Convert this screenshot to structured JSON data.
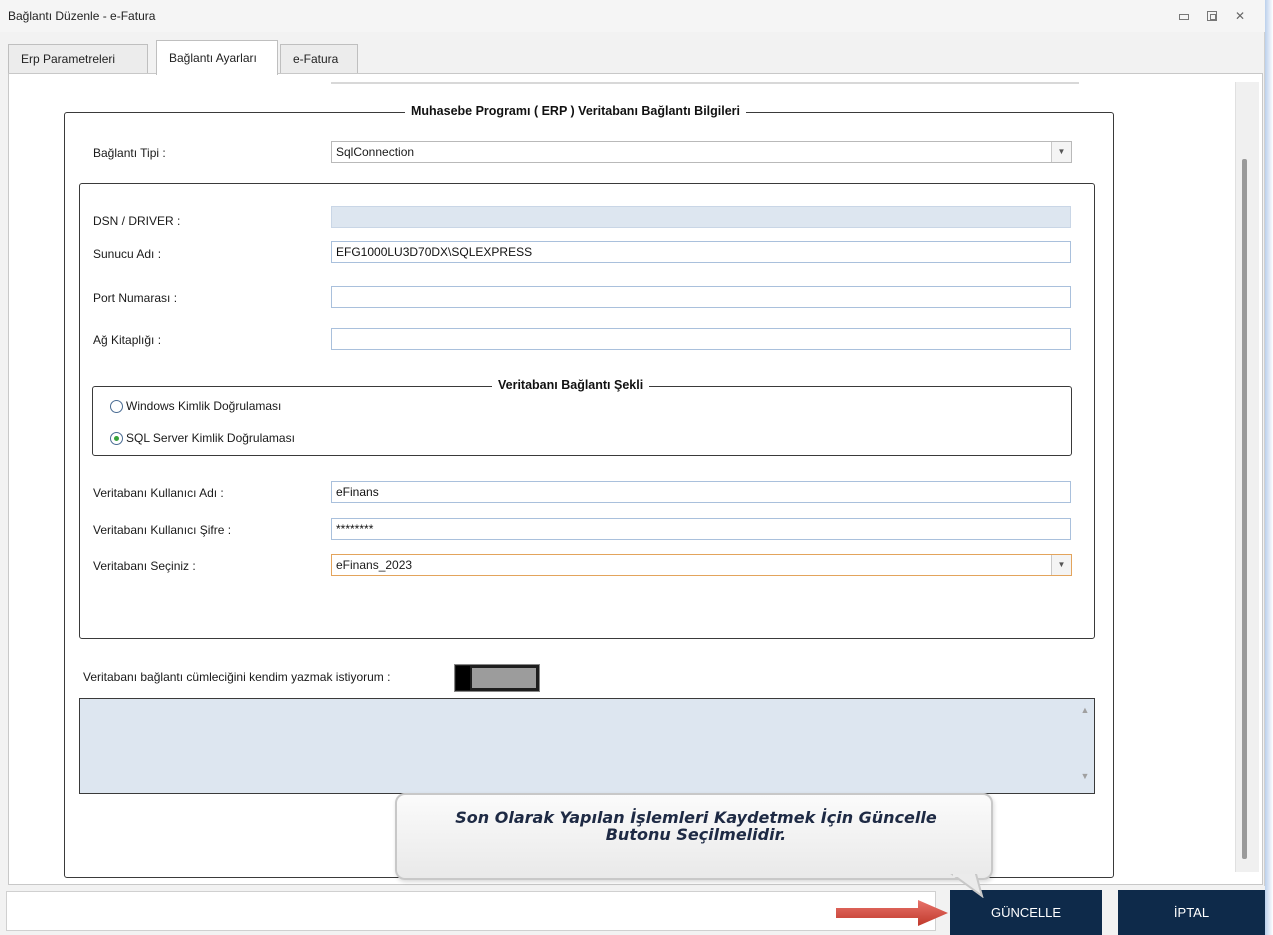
{
  "window": {
    "title": "Bağlantı Düzenle - e-Fatura"
  },
  "tabs": [
    {
      "label": "Erp Parametreleri"
    },
    {
      "label": "Bağlantı Ayarları"
    },
    {
      "label": "e-Fatura"
    }
  ],
  "connection_group": {
    "title": "Muhasebe Programı ( ERP ) Veritabanı Bağlantı Bilgileri",
    "connection_type_label": "Bağlantı Tipi :",
    "connection_type_value": "SqlConnection",
    "dsn_label": "DSN / DRIVER :",
    "dsn_value": "",
    "server_label": "Sunucu Adı :",
    "server_value": "EFG1000LU3D70DX\\SQLEXPRESS",
    "port_label": "Port Numarası :",
    "port_value": "",
    "network_lib_label": "Ağ Kitaplığı :",
    "network_lib_value": ""
  },
  "auth_group": {
    "title": "Veritabanı Bağlantı Şekli",
    "windows_auth_label": "Windows Kimlik Doğrulaması",
    "sql_auth_label": "SQL Server Kimlik Doğrulaması",
    "selected": "sql"
  },
  "credentials": {
    "username_label": "Veritabanı Kullanıcı Adı :",
    "username_value": "eFinans",
    "password_label": "Veritabanı Kullanıcı Şifre :",
    "password_value": "********",
    "database_label": "Veritabanı Seçiniz :",
    "database_value": "eFinans_2023"
  },
  "custom_connection": {
    "label": "Veritabanı bağlantı cümleciğini kendim yazmak istiyorum :",
    "enabled": false,
    "text": ""
  },
  "callout": {
    "line1": "Son Olarak Yapılan İşlemleri Kaydetmek İçin Güncelle",
    "line2": "Butonu Seçilmelidir."
  },
  "buttons": {
    "update": "GÜNCELLE",
    "cancel": "İPTAL"
  },
  "colors": {
    "button_bg": "#0e2a4a",
    "arrow": "#d9534f",
    "field_disabled": "#dde6f0"
  }
}
